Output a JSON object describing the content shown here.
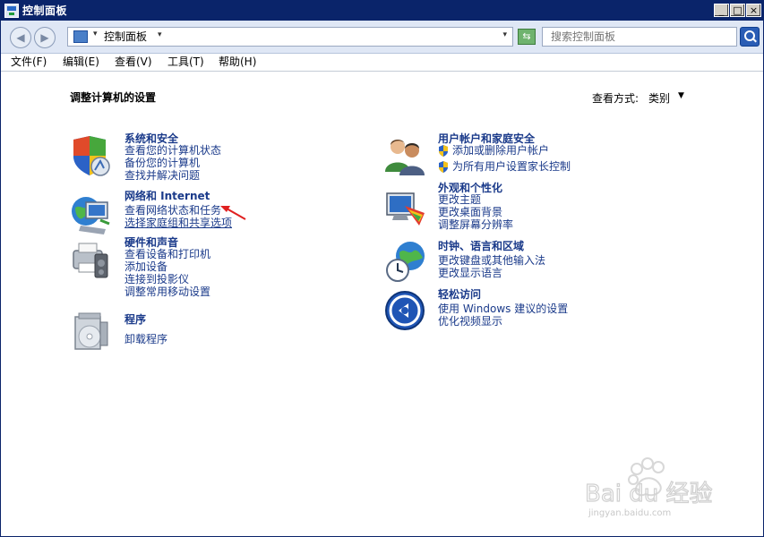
{
  "window": {
    "title": "控制面板",
    "buttons": {
      "min": "_",
      "max": "□",
      "close": "×"
    }
  },
  "address": {
    "path": "控制面板",
    "search_placeholder": "搜索控制面板",
    "back_icon": "back-arrow-icon",
    "forward_icon": "forward-arrow-icon",
    "refresh_icon": "refresh-icon",
    "search_icon": "magnifier-icon"
  },
  "menu": [
    {
      "label": "文件(F)"
    },
    {
      "label": "编辑(E)"
    },
    {
      "label": "查看(V)"
    },
    {
      "label": "工具(T)"
    },
    {
      "label": "帮助(H)"
    }
  ],
  "page": {
    "title": "调整计算机的设置",
    "view_label": "查看方式:",
    "view_value": "类别"
  },
  "categories": {
    "system": {
      "title": "系统和安全",
      "icon": "shield-system-icon",
      "links": [
        "查看您的计算机状态",
        "备份您的计算机",
        "查找并解决问题"
      ]
    },
    "network": {
      "title": "网络和 Internet",
      "icon": "network-globe-icon",
      "links": [
        "查看网络状态和任务",
        "选择家庭组和共享选项"
      ]
    },
    "hardware": {
      "title": "硬件和声音",
      "icon": "printer-hardware-icon",
      "links": [
        "查看设备和打印机",
        "添加设备",
        "连接到投影仪",
        "调整常用移动设置"
      ]
    },
    "programs": {
      "title": "程序",
      "icon": "programs-disc-icon",
      "links": [
        "卸载程序"
      ]
    },
    "users": {
      "title": "用户帐户和家庭安全",
      "icon": "users-icon",
      "links": [
        "添加或删除用户帐户",
        "为所有用户设置家长控制"
      ]
    },
    "appearance": {
      "title": "外观和个性化",
      "icon": "monitor-palette-icon",
      "links": [
        "更改主题",
        "更改桌面背景",
        "调整屏幕分辨率"
      ]
    },
    "clock": {
      "title": "时钟、语言和区域",
      "icon": "clock-globe-icon",
      "links": [
        "更改键盘或其他输入法",
        "更改显示语言"
      ]
    },
    "ease": {
      "title": "轻松访问",
      "icon": "ease-of-access-icon",
      "links": [
        "使用 Windows 建议的设置",
        "优化视频显示"
      ]
    }
  },
  "watermark": {
    "brand": "Bai du 经验",
    "url": "jingyan.baidu.com"
  },
  "colors": {
    "link": "#1a3a8a",
    "titlebar": "#0a246a",
    "arrow": "#e02020"
  }
}
